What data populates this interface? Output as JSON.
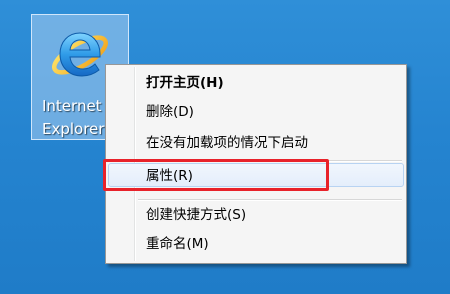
{
  "desktop": {
    "icon": {
      "name": "ie-logo-icon",
      "label_line1": "Internet",
      "label_line2": "Explorer"
    }
  },
  "context_menu": {
    "items": [
      {
        "label": "打开主页(H)",
        "default": true
      },
      {
        "label": "删除(D)"
      },
      {
        "label": "在没有加载项的情况下启动"
      },
      {
        "label": "属性(R)",
        "highlighted": true
      },
      {
        "label": "创建快捷方式(S)"
      },
      {
        "label": "重命名(M)"
      }
    ]
  },
  "colors": {
    "desktop_bg": "#2584d0",
    "menu_bg": "#f5f5f5",
    "highlight_border": "#e8222a"
  }
}
